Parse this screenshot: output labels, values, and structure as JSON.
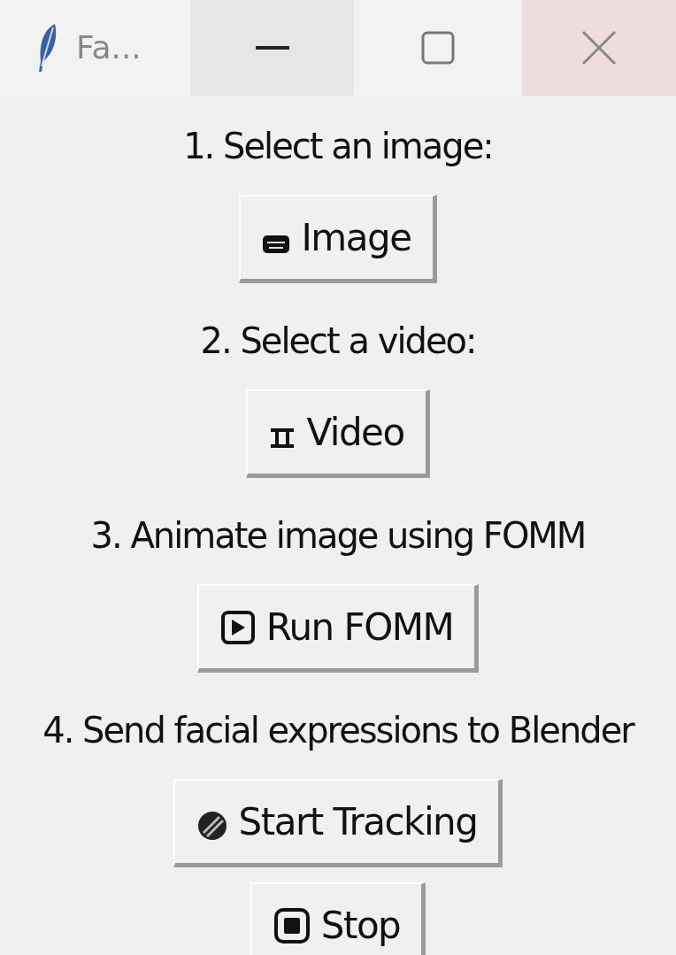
{
  "window": {
    "title": "Fa..."
  },
  "items": [
    {
      "kind": "label",
      "text": "1. Select an image:"
    },
    {
      "kind": "button",
      "label": "Image"
    },
    {
      "kind": "label",
      "text": "2. Select a video:"
    },
    {
      "kind": "button",
      "label": "Video"
    },
    {
      "kind": "label",
      "text": "3. Animate image using FOMM"
    },
    {
      "kind": "button",
      "label": "Run FOMM"
    },
    {
      "kind": "label",
      "text": "4. Send facial expressions to Blender"
    },
    {
      "kind": "button",
      "label": "Start Tracking"
    },
    {
      "kind": "button",
      "label": "Stop"
    }
  ]
}
